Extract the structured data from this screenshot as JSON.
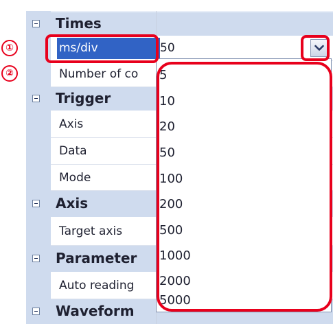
{
  "categories": {
    "times": {
      "label": "Times"
    },
    "trigger": {
      "label": "Trigger"
    },
    "axis": {
      "label": "Axis"
    },
    "parameter": {
      "label": "Parameter"
    },
    "waveform": {
      "label": "Waveform"
    }
  },
  "properties": {
    "ms_div": {
      "label": "ms/div",
      "value": "50"
    },
    "number_of_co": {
      "label": "Number of co"
    },
    "trigger_axis": {
      "label": "Axis"
    },
    "trigger_data": {
      "label": "Data"
    },
    "trigger_mode": {
      "label": "Mode"
    },
    "target_axis": {
      "label": "Target axis"
    },
    "auto_reading": {
      "label": "Auto reading"
    }
  },
  "dropdown": {
    "options": [
      "5",
      "10",
      "20",
      "50",
      "100",
      "200",
      "500",
      "1000",
      "2000",
      "5000"
    ],
    "selected": "50"
  },
  "annotations": {
    "badge1": "①",
    "badge2": "②"
  },
  "colors": {
    "category_bg": "#cfdbee",
    "selection": "#3163c5",
    "highlight": "#e8001c"
  }
}
